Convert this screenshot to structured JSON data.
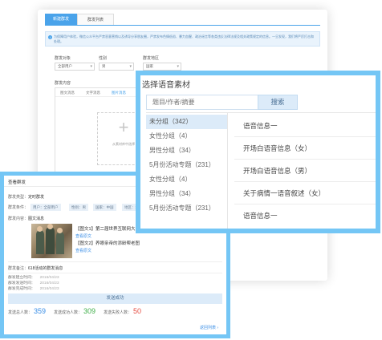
{
  "background_panel": {
    "tabs": [
      {
        "label": "新建群发"
      },
      {
        "label": "群发列表"
      }
    ],
    "notice": "为保障用户体验，微信公众平台严禁恶意营销以及诱导分享朋友圈，严禁发布色情低俗、暴力血腥、政治谣言等各类违反法律法规及相关政策规定的信息。一旦发现，我们将严厉打击和处理。",
    "fields": {
      "target_label": "群发对象",
      "target_value": "全部用户",
      "gender_label": "性别",
      "gender_value": "男",
      "region_label": "群发地区",
      "region_value": "国家",
      "content_label": "群发内容"
    },
    "content_tabs": [
      {
        "label": "图文消息"
      },
      {
        "label": "文字消息"
      },
      {
        "label": "图片消息"
      }
    ],
    "upload_text": "从素材库中选择"
  },
  "left_panel": {
    "title": "查看群发",
    "type_label": "群发类型：",
    "type_value": "定时群发",
    "condition_label": "群发条件：",
    "conditions": [
      {
        "label": "用户：全部用户"
      },
      {
        "label": "性别：男"
      },
      {
        "label": "国家：中国"
      },
      {
        "label": "地区：北京"
      }
    ],
    "content_label": "群发内容：",
    "content_value": "图文消息",
    "articles": [
      {
        "title": "【图文1】第二届世界互联网大会开幕",
        "link": "查看原文"
      },
      {
        "title": "【图文2】养眼亲帝的添龄帮老图",
        "link": "查看原文"
      }
    ],
    "remark": "群发备注：",
    "remark_value": "618活动的群发消息",
    "meta": [
      {
        "label": "群发建立时间：",
        "value": "2016/04/23"
      },
      {
        "label": "群发发送时间：",
        "value": "2016/04/23"
      },
      {
        "label": "群发完成时间：",
        "value": "2016/04/23"
      }
    ],
    "success_text": "发送成功",
    "stats": [
      {
        "label": "发送总人数：",
        "value": "359",
        "color": "#3a8ee6"
      },
      {
        "label": "发送成功人数：",
        "value": "309",
        "color": "#3fae49"
      },
      {
        "label": "发送失败人数：",
        "value": "50",
        "color": "#e54d42"
      }
    ],
    "return_link": "返回列表 ›"
  },
  "right_panel": {
    "title": "选择语音素材",
    "search_placeholder": "题目/作者/摘要",
    "search_button": "搜索",
    "categories": [
      {
        "label": "未分组（342）",
        "active": true
      },
      {
        "label": "女性分组（4）",
        "active": false
      },
      {
        "label": "男性分组（34）",
        "active": false
      },
      {
        "label": "5月份活动专题（231）",
        "active": false
      },
      {
        "label": "女性分组（4）",
        "active": false
      },
      {
        "label": "男性分组（34）",
        "active": false
      },
      {
        "label": "5月份活动专题（231）",
        "active": false
      }
    ],
    "items": [
      {
        "label": "语音信息一"
      },
      {
        "label": "开场白语音信息（女）"
      },
      {
        "label": "开场白语音信息（男）"
      },
      {
        "label": "关于病情一语音叙述（女）"
      },
      {
        "label": "语音信息一"
      }
    ]
  },
  "colors": {
    "accent": "#74c6f5",
    "primary_blue": "#4aa3ea",
    "selected_bg": "#dcebf9"
  }
}
